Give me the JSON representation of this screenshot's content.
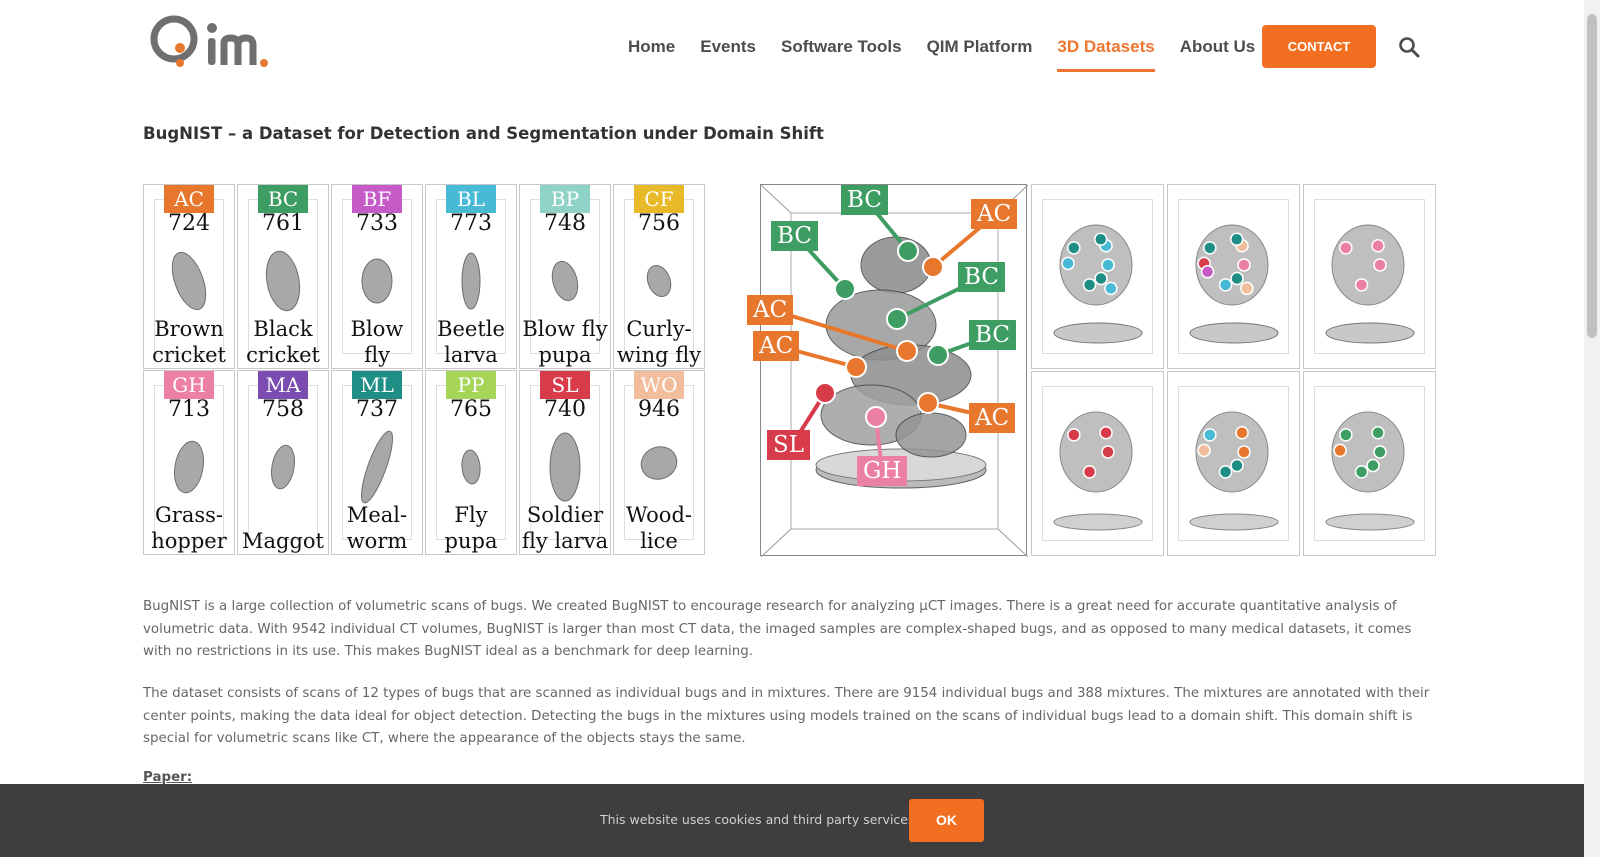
{
  "header": {
    "logo_alt": "QIM",
    "nav": [
      {
        "label": "Home",
        "active": false
      },
      {
        "label": "Events",
        "active": false
      },
      {
        "label": "Software Tools",
        "active": false
      },
      {
        "label": "QIM Platform",
        "active": false
      },
      {
        "label": "3D Datasets",
        "active": true
      },
      {
        "label": "About Us",
        "active": false
      }
    ],
    "contact_label": "CONTACT",
    "accent_color": "#f26f21"
  },
  "page": {
    "title": "BugNIST – a Dataset for Detection and Segmentation under Domain Shift"
  },
  "figure": {
    "species": [
      {
        "code": "AC",
        "count": "724",
        "name1": "Brown",
        "name2": "cricket",
        "color": "#e8772e"
      },
      {
        "code": "BC",
        "count": "761",
        "name1": "Black",
        "name2": "cricket",
        "color": "#3e9d63"
      },
      {
        "code": "BF",
        "count": "733",
        "name1": "Blow",
        "name2": "fly",
        "color": "#c65bc8"
      },
      {
        "code": "BL",
        "count": "773",
        "name1": "Beetle",
        "name2": "larva",
        "color": "#49bad5"
      },
      {
        "code": "BP",
        "count": "748",
        "name1": "Blow fly",
        "name2": "pupa",
        "color": "#8fd3c6"
      },
      {
        "code": "CF",
        "count": "756",
        "name1": "Curly-",
        "name2": "wing fly",
        "color": "#e8b928"
      },
      {
        "code": "GH",
        "count": "713",
        "name1": "Grass-",
        "name2": "hopper",
        "color": "#ec7fa6"
      },
      {
        "code": "MA",
        "count": "758",
        "name1": "Maggot",
        "name2": "",
        "color": "#7c4db0"
      },
      {
        "code": "ML",
        "count": "737",
        "name1": "Meal-",
        "name2": "worm",
        "color": "#1f8f86"
      },
      {
        "code": "PP",
        "count": "765",
        "name1": "Fly",
        "name2": "pupa",
        "color": "#a6d55a"
      },
      {
        "code": "SL",
        "count": "740",
        "name1": "Soldier",
        "name2": "fly larva",
        "color": "#d83b4a"
      },
      {
        "code": "WO",
        "count": "946",
        "name1": "Wood-",
        "name2": "lice",
        "color": "#f2bd9c"
      }
    ],
    "callouts": [
      {
        "code": "BC",
        "color": "#3e9d63"
      },
      {
        "code": "AC",
        "color": "#e8772e"
      },
      {
        "code": "BC",
        "color": "#3e9d63"
      },
      {
        "code": "BC",
        "color": "#3e9d63"
      },
      {
        "code": "AC",
        "color": "#e8772e"
      },
      {
        "code": "BC",
        "color": "#3e9d63"
      },
      {
        "code": "AC",
        "color": "#e8772e"
      },
      {
        "code": "AC",
        "color": "#e8772e"
      },
      {
        "code": "SL",
        "color": "#d83b4a"
      },
      {
        "code": "GH",
        "color": "#ec7fa6"
      }
    ]
  },
  "content": {
    "paragraph1": "BugNIST is a large collection of volumetric scans of bugs. We created BugNIST to encourage research for analyzing µCT images. There is a great need for accurate quantitative analysis of volumetric data. With 9542 individual CT volumes, BugNIST is larger than most CT data, the imaged samples are complex-shaped bugs, and as opposed to many medical datasets, it comes with no restrictions in its use. This makes BugNIST ideal as a benchmark for deep learning.",
    "paragraph2": "The dataset consists of scans of 12 types of bugs that are scanned as individual bugs and in mixtures. There are 9154 individual bugs and 388 mixtures. The mixtures are annotated with their center points, making the data ideal for object detection. Detecting the bugs in the mixtures using models trained on the scans of individual bugs lead to a domain shift. This domain shift is special for volumetric scans like CT, where the appearance of the objects stays the same.",
    "paper_label": "Paper:"
  },
  "cookie": {
    "text": "This website uses cookies and third party services.",
    "ok_label": "OK"
  }
}
